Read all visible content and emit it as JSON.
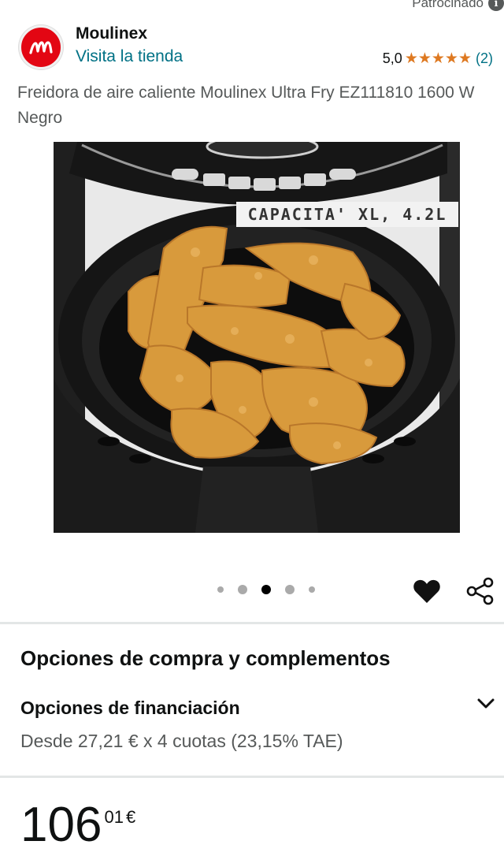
{
  "sponsored": {
    "label": "Patrocinado",
    "info_icon": "i"
  },
  "brand": {
    "name": "Moulinex",
    "visit_store": "Visita la tienda",
    "logo_letter": "M",
    "logo_color": "#e30613"
  },
  "rating": {
    "value": "5,0",
    "stars_display": "★★★★★",
    "stars": 5,
    "count": "(2)"
  },
  "product": {
    "title": "Freidora de aire caliente Moulinex Ultra Fry EZ111810 1600 W Negro"
  },
  "image": {
    "overlay_text": "CAPACITA' XL, 4.2L"
  },
  "carousel": {
    "total": 5,
    "active_index": 2
  },
  "actions": {
    "favorite_icon": "heart-icon",
    "share_icon": "share-icon"
  },
  "purchase_options": {
    "heading": "Opciones de compra y complementos"
  },
  "financing": {
    "title": "Opciones de financiación",
    "detail": "Desde 27,21 € x 4 cuotas (23,15% TAE)"
  },
  "price": {
    "whole": "106",
    "fraction": "01",
    "currency": "€"
  },
  "colors": {
    "link": "#007185",
    "star": "#de7921",
    "text": "#0f1111",
    "secondary_text": "#565959"
  }
}
